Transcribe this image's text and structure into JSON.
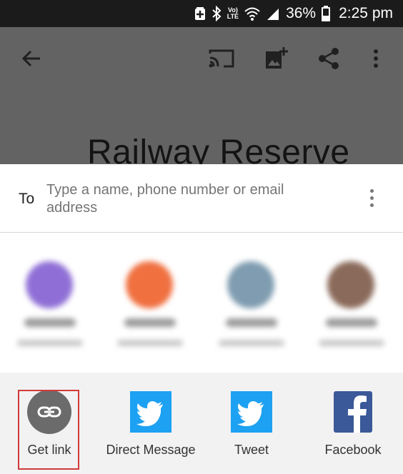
{
  "status_bar": {
    "lte_top": "Vo)",
    "lte_bottom": "LTE",
    "battery": "36%",
    "time": "2:25 pm",
    "icons": [
      "battery-saver-icon",
      "bluetooth-icon",
      "volte-icon",
      "wifi-icon",
      "signal-icon",
      "battery-icon"
    ]
  },
  "toolbar": {
    "icons": [
      "back-arrow-icon",
      "cast-icon",
      "add-image-icon",
      "share-icon",
      "more-vert-icon"
    ]
  },
  "document": {
    "title": "Railway Reserve"
  },
  "share_sheet": {
    "to_label": "To",
    "to_placeholder": "Type a name, phone number or email address",
    "contacts": [
      {
        "avatar_color": "#8f6fd6"
      },
      {
        "avatar_color": "#f07040"
      },
      {
        "avatar_color": "#7f9cb0"
      },
      {
        "avatar_color": "#8a6a5a"
      }
    ],
    "apps": [
      {
        "label": "Get link",
        "icon": "link-icon",
        "color": "#6b6b6b"
      },
      {
        "label": "Direct Message",
        "icon": "twitter-icon",
        "color": "#1da1f2"
      },
      {
        "label": "Tweet",
        "icon": "twitter-icon",
        "color": "#1da1f2"
      },
      {
        "label": "Facebook",
        "icon": "facebook-icon",
        "color": "#3b5998"
      }
    ]
  }
}
